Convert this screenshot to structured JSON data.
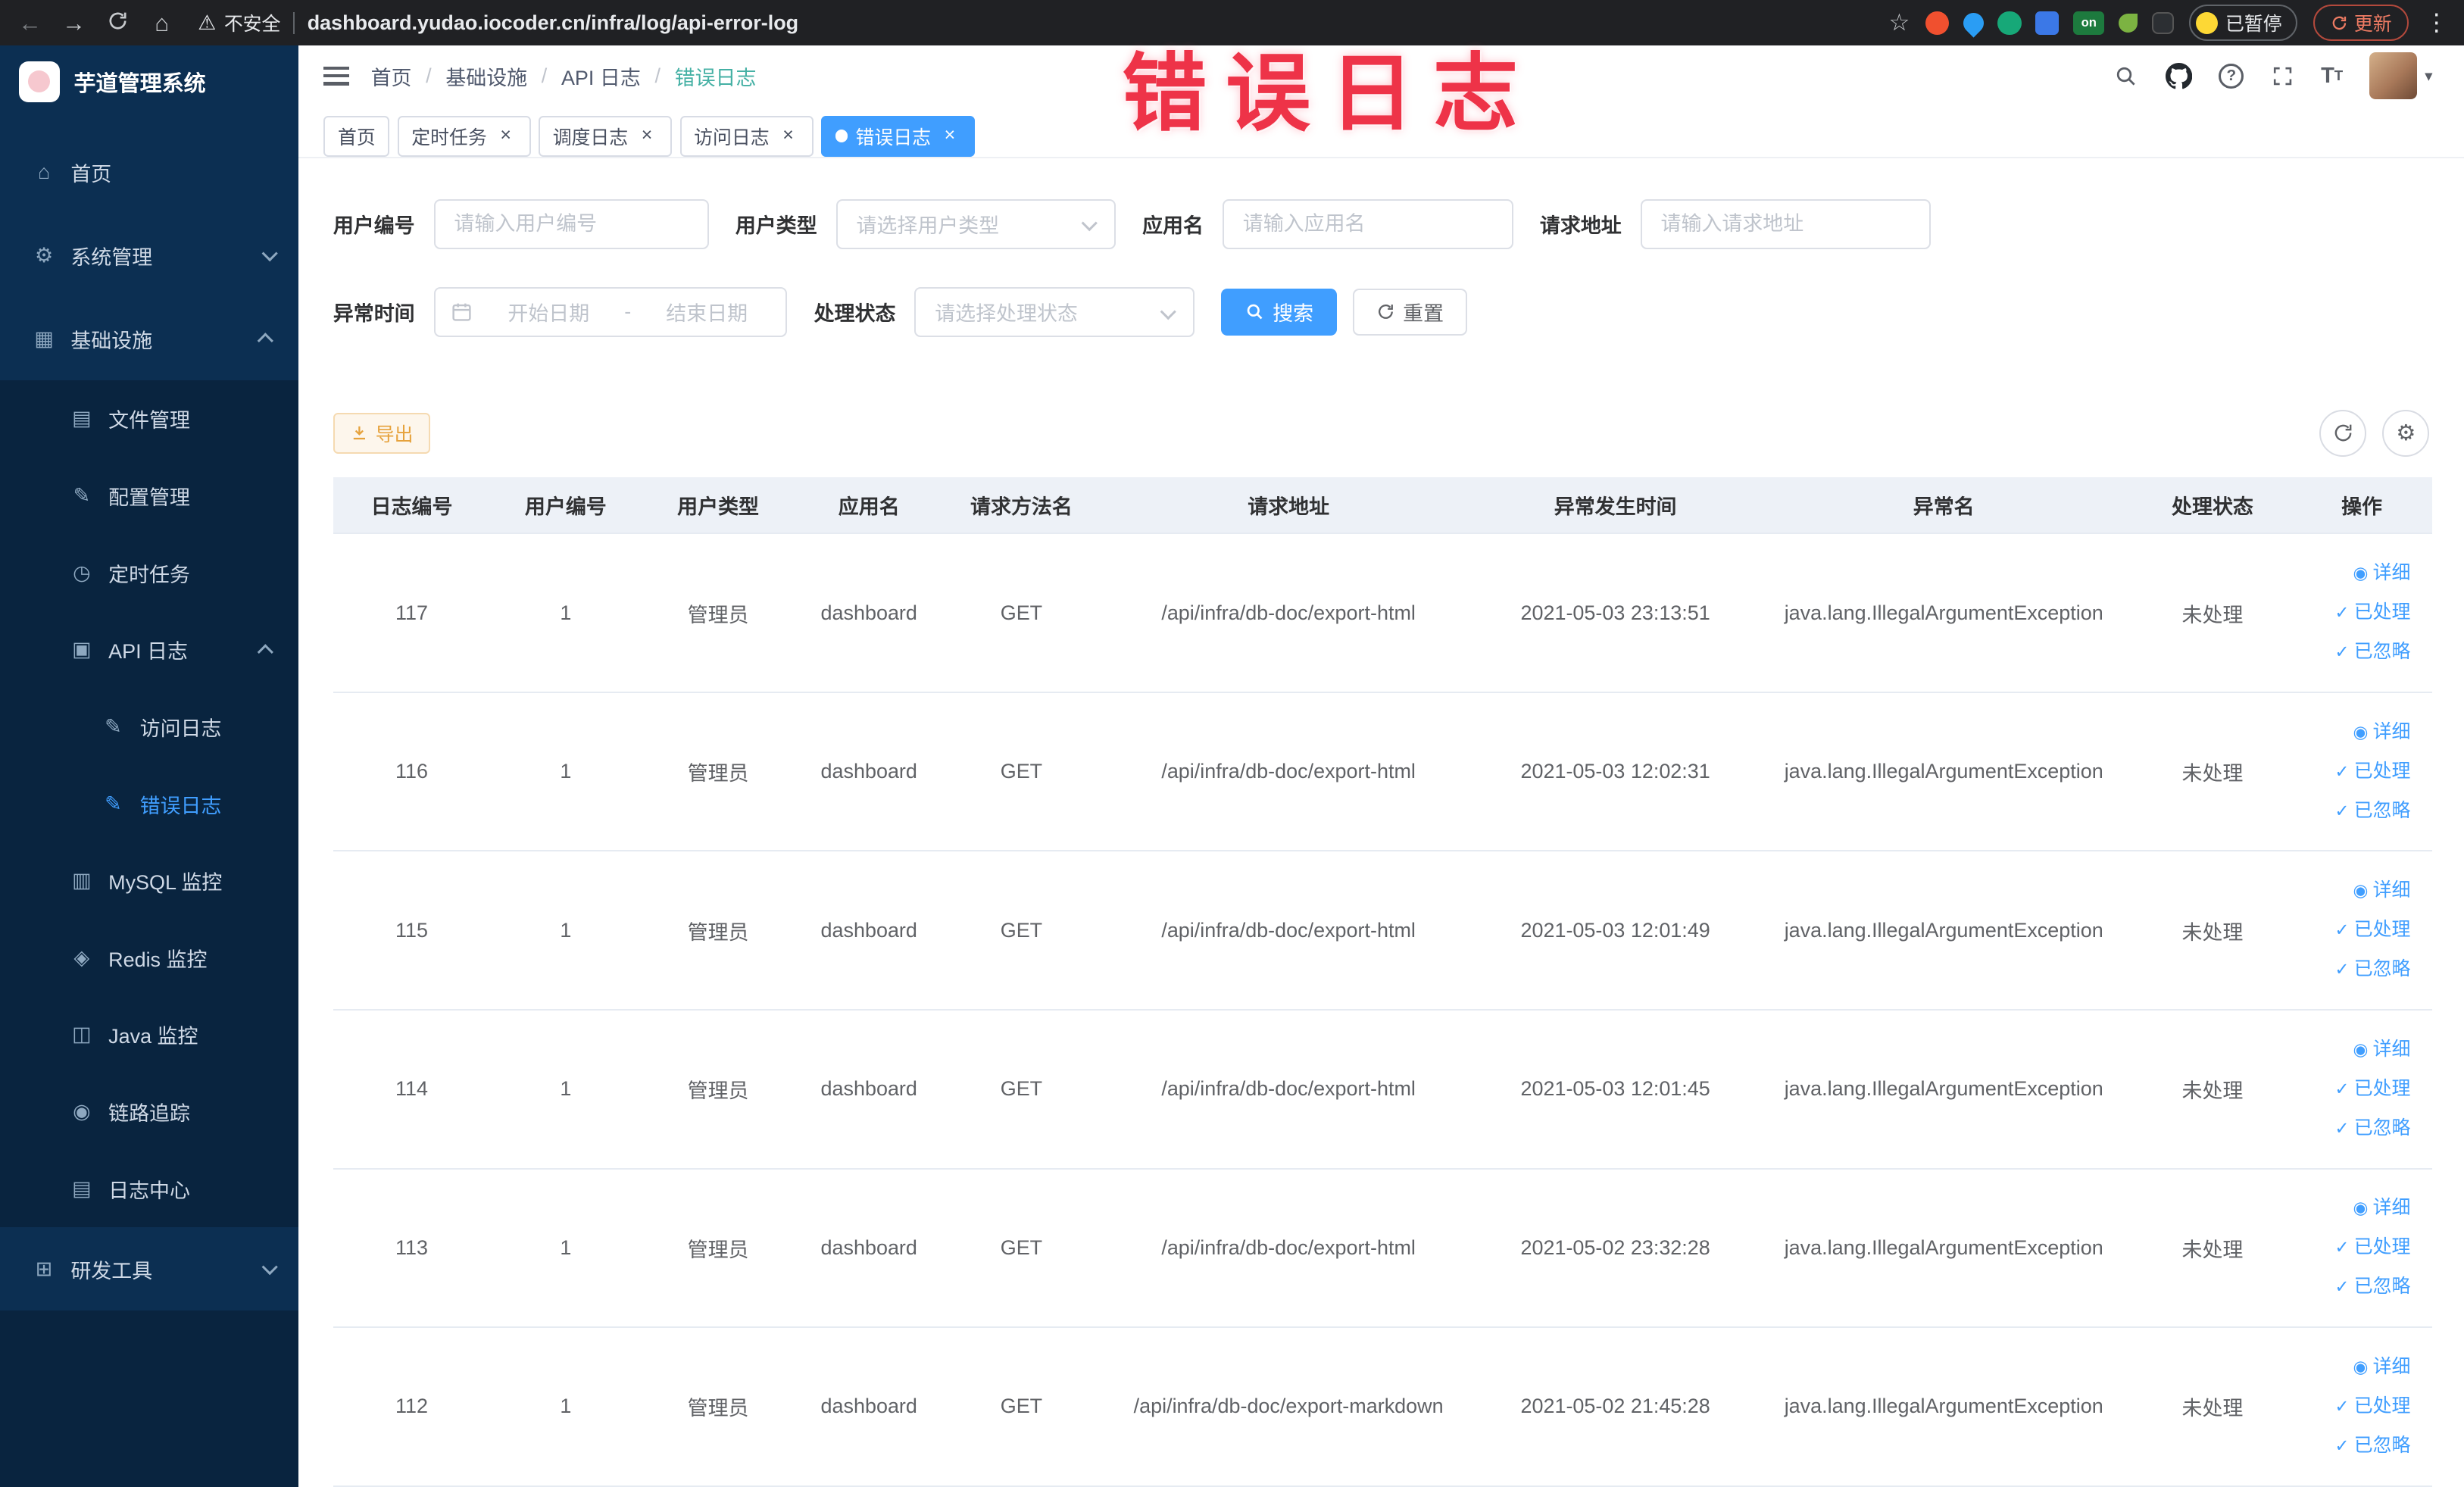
{
  "browser": {
    "security_label": "不安全",
    "url": "dashboard.yudao.iocoder.cn/infra/log/api-error-log",
    "paused_label": "已暂停",
    "update_label": "更新",
    "on_badge": "on"
  },
  "watermark": "错误日志",
  "sidebar": {
    "logo_title": "芋道管理系统",
    "items": [
      {
        "label": "首页",
        "icon": "home-icon",
        "level": 1
      },
      {
        "label": "系统管理",
        "icon": "gear-icon",
        "level": 1,
        "arrow": "down"
      },
      {
        "label": "基础设施",
        "icon": "infrastructure-icon",
        "level": 1,
        "arrow": "up"
      },
      {
        "label": "文件管理",
        "icon": "folder-icon",
        "level": 2
      },
      {
        "label": "配置管理",
        "icon": "edit-icon",
        "level": 2
      },
      {
        "label": "定时任务",
        "icon": "timer-icon",
        "level": 2
      },
      {
        "label": "API 日志",
        "icon": "document-icon",
        "level": 2,
        "arrow": "up"
      },
      {
        "label": "访问日志",
        "icon": "edit-icon",
        "level": 3
      },
      {
        "label": "错误日志",
        "icon": "edit-icon",
        "level": 3,
        "active": true
      },
      {
        "label": "MySQL 监控",
        "icon": "database-icon",
        "level": 2
      },
      {
        "label": "Redis 监控",
        "icon": "redis-icon",
        "level": 2
      },
      {
        "label": "Java 监控",
        "icon": "java-icon",
        "level": 2
      },
      {
        "label": "链路追踪",
        "icon": "eye-icon",
        "level": 2
      },
      {
        "label": "日志中心",
        "icon": "log-icon",
        "level": 2
      },
      {
        "label": "研发工具",
        "icon": "tools-icon",
        "level": 1,
        "arrow": "down"
      }
    ]
  },
  "header": {
    "breadcrumb": [
      "首页",
      "基础设施",
      "API 日志",
      "错误日志"
    ],
    "separator": "/",
    "icons": [
      "search-icon",
      "github-icon",
      "help-icon",
      "fullscreen-icon",
      "font-size-icon",
      "avatar"
    ]
  },
  "tabs": [
    {
      "label": "首页",
      "closable": false,
      "active": false
    },
    {
      "label": "定时任务",
      "closable": true,
      "active": false
    },
    {
      "label": "调度日志",
      "closable": true,
      "active": false
    },
    {
      "label": "访问日志",
      "closable": true,
      "active": false
    },
    {
      "label": "错误日志",
      "closable": true,
      "active": true
    }
  ],
  "filters": {
    "user_id_label": "用户编号",
    "user_id_placeholder": "请输入用户编号",
    "user_type_label": "用户类型",
    "user_type_placeholder": "请选择用户类型",
    "app_name_label": "应用名",
    "app_name_placeholder": "请输入应用名",
    "request_url_label": "请求地址",
    "request_url_placeholder": "请输入请求地址",
    "exception_time_label": "异常时间",
    "start_date_placeholder": "开始日期",
    "range_separator": "-",
    "end_date_placeholder": "结束日期",
    "process_status_label": "处理状态",
    "process_status_placeholder": "请选择处理状态",
    "search_label": "搜索",
    "reset_label": "重置"
  },
  "toolbar": {
    "export_label": "导出"
  },
  "table": {
    "headers": [
      "日志编号",
      "用户编号",
      "用户类型",
      "应用名",
      "请求方法名",
      "请求地址",
      "异常发生时间",
      "异常名",
      "处理状态",
      "操作"
    ],
    "actions": [
      "详细",
      "已处理",
      "已忽略"
    ],
    "rows": [
      {
        "log_id": "117",
        "user_id": "1",
        "user_type": "管理员",
        "app_name": "dashboard",
        "method": "GET",
        "url": "/api/infra/db-doc/export-html",
        "time": "2021-05-03 23:13:51",
        "exception": "java.lang.IllegalArgumentException",
        "status": "未处理"
      },
      {
        "log_id": "116",
        "user_id": "1",
        "user_type": "管理员",
        "app_name": "dashboard",
        "method": "GET",
        "url": "/api/infra/db-doc/export-html",
        "time": "2021-05-03 12:02:31",
        "exception": "java.lang.IllegalArgumentException",
        "status": "未处理"
      },
      {
        "log_id": "115",
        "user_id": "1",
        "user_type": "管理员",
        "app_name": "dashboard",
        "method": "GET",
        "url": "/api/infra/db-doc/export-html",
        "time": "2021-05-03 12:01:49",
        "exception": "java.lang.IllegalArgumentException",
        "status": "未处理"
      },
      {
        "log_id": "114",
        "user_id": "1",
        "user_type": "管理员",
        "app_name": "dashboard",
        "method": "GET",
        "url": "/api/infra/db-doc/export-html",
        "time": "2021-05-03 12:01:45",
        "exception": "java.lang.IllegalArgumentException",
        "status": "未处理"
      },
      {
        "log_id": "113",
        "user_id": "1",
        "user_type": "管理员",
        "app_name": "dashboard",
        "method": "GET",
        "url": "/api/infra/db-doc/export-html",
        "time": "2021-05-02 23:32:28",
        "exception": "java.lang.IllegalArgumentException",
        "status": "未处理"
      },
      {
        "log_id": "112",
        "user_id": "1",
        "user_type": "管理员",
        "app_name": "dashboard",
        "method": "GET",
        "url": "/api/infra/db-doc/export-markdown",
        "time": "2021-05-02 21:45:28",
        "exception": "java.lang.IllegalArgumentException",
        "status": "未处理"
      }
    ]
  }
}
